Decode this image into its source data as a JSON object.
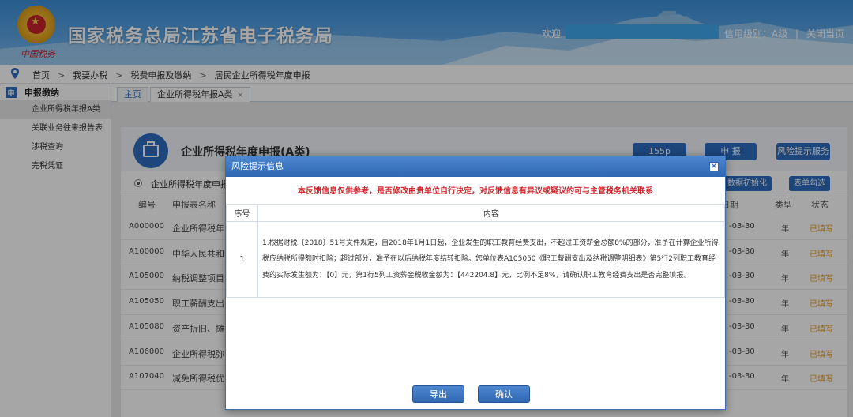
{
  "header": {
    "site_title": "国家税务总局江苏省电子税务局",
    "emblem_signature": "中国税务",
    "welcome_label": "欢迎",
    "credit_level": "信用级别：A级",
    "separator": "|",
    "close_page": "关闭当页"
  },
  "breadcrumb": {
    "items": [
      "首页",
      "我要办税",
      "税费申报及缴纳",
      "居民企业所得税年度申报"
    ],
    "separator": ">"
  },
  "sidebar": {
    "section_icon": "申",
    "section_title": "申报缴纳",
    "items": [
      {
        "label": "企业所得税年报A类",
        "active": true
      },
      {
        "label": "关联业务往来报告表",
        "active": false
      },
      {
        "label": "涉税查询",
        "active": false
      },
      {
        "label": "完税凭证",
        "active": false
      }
    ]
  },
  "tabs": {
    "home": "主页",
    "current": "企业所得税年报A类",
    "close_glyph": "×"
  },
  "main": {
    "panel_title": "企业所得税年度申报(A类)",
    "buttons": {
      "b1": "155p",
      "declare": "申 报",
      "risk_service": "风险提示服务",
      "init_data": "数据初始化",
      "select_form": "表单勾选"
    },
    "sub_label": "企业所得税年度申报",
    "columns": {
      "code": "编号",
      "name": "申报表名称",
      "date": "日期",
      "type": "类型",
      "status": "状态"
    },
    "rows": [
      {
        "code": "A000000",
        "name": "企业所得税年",
        "date": "-03-30",
        "type": "年",
        "status": "已填写"
      },
      {
        "code": "A100000",
        "name": "中华人民共和",
        "date": "-03-30",
        "type": "年",
        "status": "已填写"
      },
      {
        "code": "A105000",
        "name": "纳税调整项目",
        "date": "-03-30",
        "type": "年",
        "status": "已填写"
      },
      {
        "code": "A105050",
        "name": "职工薪酬支出",
        "date": "-03-30",
        "type": "年",
        "status": "已填写"
      },
      {
        "code": "A105080",
        "name": "资产折旧、摊",
        "date": "-03-30",
        "type": "年",
        "status": "已填写"
      },
      {
        "code": "A106000",
        "name": "企业所得税弥",
        "date": "-03-30",
        "type": "年",
        "status": "已填写"
      },
      {
        "code": "A107040",
        "name": "减免所得税优",
        "date": "-03-30",
        "type": "年",
        "status": "已填写"
      }
    ]
  },
  "modal": {
    "title": "风险提示信息",
    "close_glyph": "×",
    "warning": "本反馈信息仅供参考，是否修改由贵单位自行决定，对反馈信息有异议或疑议的可与主管税务机关联系",
    "col_no": "序号",
    "col_content": "内容",
    "row_no": "1",
    "row_content": "1.根据财税〔2018〕51号文件规定，自2018年1月1日起，企业发生的职工教育经费支出，不超过工资薪金总额8%的部分，准予在计算企业所得税应纳税所得额时扣除；超过部分，准予在以后纳税年度结转扣除。您单位表A105050《职工薪酬支出及纳税调整明细表》第5行2列职工教育经费的实际发生额为：【0】元，第1行5列工资薪金税收金额为：【442204.8】元，比例不足8%，请确认职工教育经费支出是否完整填报。",
    "export_button": "导出",
    "confirm_button": "确认"
  },
  "colors": {
    "brand_blue": "#2b6cbf",
    "warning_red": "#d0282e",
    "status_orange": "#e49a1c"
  }
}
